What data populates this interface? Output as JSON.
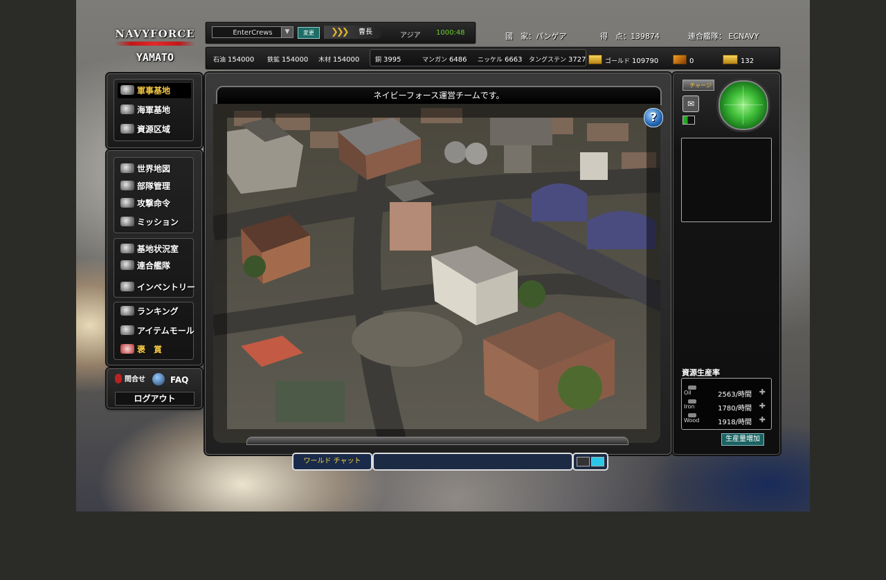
{
  "logo": {
    "line1": "NAVYFORCE",
    "line2": "YAMATO"
  },
  "header": {
    "server": "EnterCrews",
    "change_label": "変更",
    "rank": "曹長",
    "region": "アジア",
    "timer": "1000:48",
    "nation": "國　家：パンゲア",
    "score": "得　点：139874",
    "fleet": "連合艦隊：  ECNAVY"
  },
  "resources": {
    "oil": {
      "name": "石油",
      "value": "154000"
    },
    "iron": {
      "name": "鉄鉱",
      "value": "154000"
    },
    "wood": {
      "name": "木材",
      "value": "154000"
    },
    "copper": {
      "name": "銅",
      "value": "3995"
    },
    "manganese": {
      "name": "マンガン",
      "value": "6486"
    },
    "nickel": {
      "name": "ニッケル",
      "value": "6663"
    },
    "tungsten": {
      "name": "タングステン",
      "value": "3727"
    },
    "gold": {
      "name": "ゴールド",
      "value": "109790"
    },
    "ticket": "0",
    "cash": "132"
  },
  "nav": {
    "group1": [
      {
        "label": "軍事基地",
        "icon": "base-icon"
      },
      {
        "label": "海軍基地",
        "icon": "anchor-icon"
      },
      {
        "label": "資源区域",
        "icon": "resource-area-icon"
      }
    ],
    "group2": [
      {
        "label": "世界地図",
        "icon": "globe-icon"
      },
      {
        "label": "部隊管理",
        "icon": "ship-icon"
      },
      {
        "label": "攻撃命令",
        "icon": "plane-icon"
      },
      {
        "label": "ミッション",
        "icon": "document-icon"
      }
    ],
    "group3": [
      {
        "label": "基地状況室",
        "icon": "building-icon"
      },
      {
        "label": "連合艦隊",
        "icon": "fleet-icon"
      },
      {
        "label": "インベントリー",
        "icon": "inventory-icon"
      }
    ],
    "group4": [
      {
        "label": "ランキング",
        "icon": "ranking-icon"
      },
      {
        "label": "アイテムモール",
        "icon": "item-mall-icon"
      },
      {
        "label": "褒　賞",
        "icon": "gift-icon"
      }
    ],
    "contact": "問合せ",
    "faq": "FAQ",
    "logout": "ログアウト"
  },
  "main": {
    "announcement": "ネイビーフォース運営チームです。",
    "help": "?"
  },
  "right": {
    "charge": "チャージ",
    "production_title": "資源生産率",
    "production": [
      {
        "name": "Oil",
        "rate": "2563/時間"
      },
      {
        "name": "Iron",
        "rate": "1780/時間"
      },
      {
        "name": "Wood",
        "rate": "1918/時間"
      }
    ],
    "boost": "生産量増加"
  },
  "chat": {
    "tab": "ワールド チャット"
  },
  "colors": {
    "accent_gold": "#f3c743",
    "timer_green": "#6bd12c",
    "button_teal": "#1d6c66"
  }
}
